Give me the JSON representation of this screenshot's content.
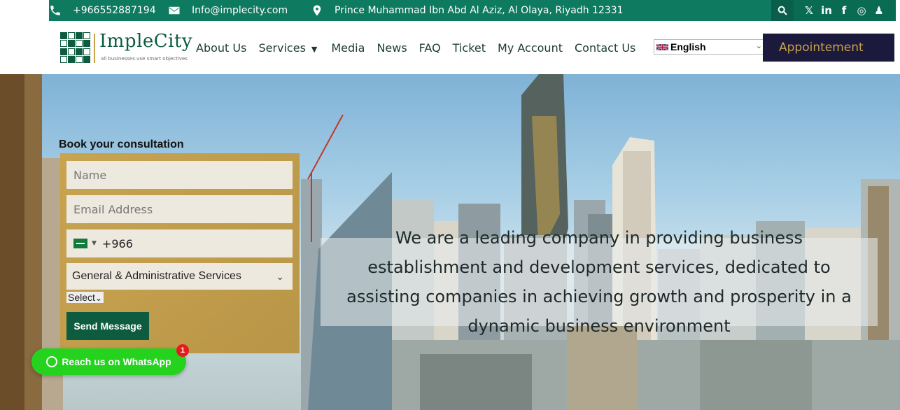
{
  "topbar": {
    "phone": "+966552887194",
    "email": "Info@implecity.com",
    "address": "Prince Muhammad Ibn Abd Al Aziz, Al Olaya, Riyadh 12331",
    "social": [
      "x-icon",
      "linkedin-icon",
      "facebook-icon",
      "instagram-icon",
      "snapchat-icon"
    ]
  },
  "logo": {
    "name": "ImpleCity",
    "tagline": "all businesses use smart objectives"
  },
  "nav": {
    "items": [
      "About Us",
      "Services",
      "Media",
      "News",
      "FAQ",
      "Ticket",
      "My Account",
      "Contact Us"
    ],
    "language": "English",
    "appointment": "Appointement"
  },
  "form": {
    "title": "Book your consultation",
    "name_placeholder": "Name",
    "email_placeholder": "Email Address",
    "phone_code": "+966",
    "service": "General & Administrative Services",
    "select_label": "Select",
    "submit": "Send Message"
  },
  "whatsapp": {
    "label": "Reach us on WhatsApp",
    "badge": "1"
  },
  "hero": {
    "tagline": "We are a leading company in providing business establishment and development services, dedicated to assisting companies in achieving growth and prosperity in a dynamic business environment"
  },
  "colors": {
    "brand_green": "#0e7a5f",
    "dark_green": "#0e5c3f",
    "gold": "#c9a24a",
    "navy": "#1b1a3d",
    "whatsapp": "#25d31f"
  }
}
